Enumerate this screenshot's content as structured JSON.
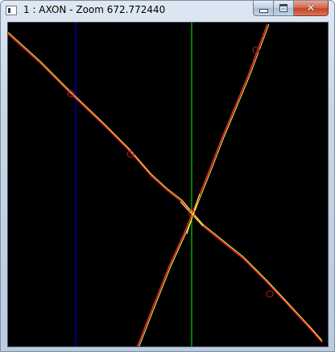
{
  "window": {
    "title": "1 : AXON - Zoom 672.772440",
    "icon": "window-app-icon"
  },
  "caption_buttons": {
    "minimize_icon": "minimize-icon",
    "maximize_icon": "maximize-icon",
    "close_icon": "close-icon",
    "close_glyph": "✕"
  },
  "canvas": {
    "background": "#000000",
    "colors": {
      "blue_line": "#0000ff",
      "green_line": "#00ff00",
      "red_axon": "#ff2a2a",
      "yellow_axon": "#ffff55",
      "node_marker": "#aa2222"
    }
  }
}
